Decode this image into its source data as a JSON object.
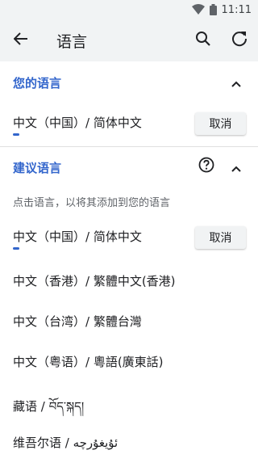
{
  "status_bar": {
    "time": "11:11"
  },
  "app_bar": {
    "title": "语言"
  },
  "your_languages": {
    "header": "您的语言",
    "items": [
      {
        "name": "中文（中国）/ 简体中文",
        "action": "取消"
      }
    ]
  },
  "suggested_languages": {
    "header": "建议语言",
    "hint": "点击语言，以将其添加到您的语言",
    "items": [
      {
        "name": "中文（中国）/ 简体中文",
        "action": "取消"
      },
      {
        "name": "中文（香港）/ 繁體中文(香港)"
      },
      {
        "name": "中文（台湾）/ 繁體台灣"
      },
      {
        "name": "中文（粤语）/ 粵語(廣東話)"
      },
      {
        "name": "藏语 / བོད་སྐད།"
      },
      {
        "name": "维吾尔语 / ئۇيغۇرچە"
      }
    ]
  },
  "colors": {
    "accent": "#3366cc",
    "appbar_bg": "#f1f3f4"
  },
  "icons": {
    "back": "arrow-back-icon",
    "search": "search-icon",
    "refresh": "refresh-icon",
    "chevron": "chevron-up-icon",
    "help": "help-icon",
    "wifi": "wifi-icon",
    "battery": "battery-icon"
  }
}
